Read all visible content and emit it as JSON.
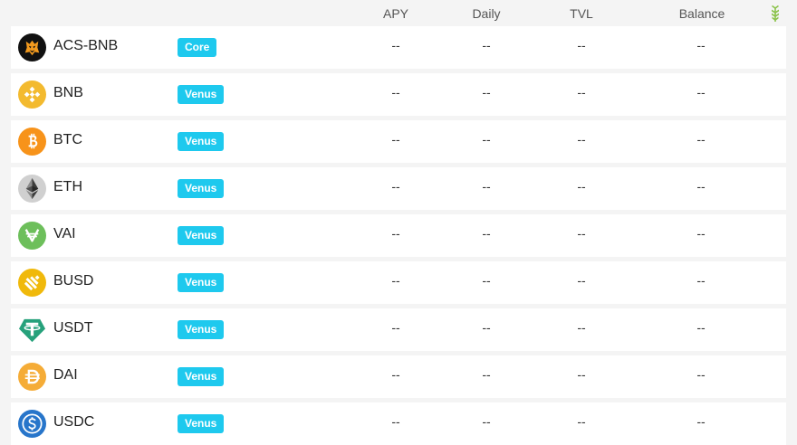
{
  "header": {
    "apy": "APY",
    "daily": "Daily",
    "tvl": "TVL",
    "balance": "Balance"
  },
  "rows": [
    {
      "name": "ACS-BNB",
      "badge": "Core",
      "icon": "acs-bnb-icon",
      "apy": "--",
      "daily": "--",
      "tvl": "--",
      "balance": "--"
    },
    {
      "name": "BNB",
      "badge": "Venus",
      "icon": "bnb-icon",
      "apy": "--",
      "daily": "--",
      "tvl": "--",
      "balance": "--"
    },
    {
      "name": "BTC",
      "badge": "Venus",
      "icon": "btc-icon",
      "apy": "--",
      "daily": "--",
      "tvl": "--",
      "balance": "--"
    },
    {
      "name": "ETH",
      "badge": "Venus",
      "icon": "eth-icon",
      "apy": "--",
      "daily": "--",
      "tvl": "--",
      "balance": "--"
    },
    {
      "name": "VAI",
      "badge": "Venus",
      "icon": "vai-icon",
      "apy": "--",
      "daily": "--",
      "tvl": "--",
      "balance": "--"
    },
    {
      "name": "BUSD",
      "badge": "Venus",
      "icon": "busd-icon",
      "apy": "--",
      "daily": "--",
      "tvl": "--",
      "balance": "--"
    },
    {
      "name": "USDT",
      "badge": "Venus",
      "icon": "usdt-icon",
      "apy": "--",
      "daily": "--",
      "tvl": "--",
      "balance": "--"
    },
    {
      "name": "DAI",
      "badge": "Venus",
      "icon": "dai-icon",
      "apy": "--",
      "daily": "--",
      "tvl": "--",
      "balance": "--"
    },
    {
      "name": "USDC",
      "badge": "Venus",
      "icon": "usdc-icon",
      "apy": "--",
      "daily": "--",
      "tvl": "--",
      "balance": "--"
    }
  ],
  "colors": {
    "badge": "#1ec9ee",
    "sort_icon": "#8bc34a",
    "bnb": "#f3ba2f",
    "btc": "#f7931a",
    "eth": "#c8c8c8",
    "vai": "#6dbf5b",
    "busd": "#f0b90b",
    "usdt": "#26a17b",
    "dai": "#f5ac37",
    "usdc": "#2775ca"
  }
}
